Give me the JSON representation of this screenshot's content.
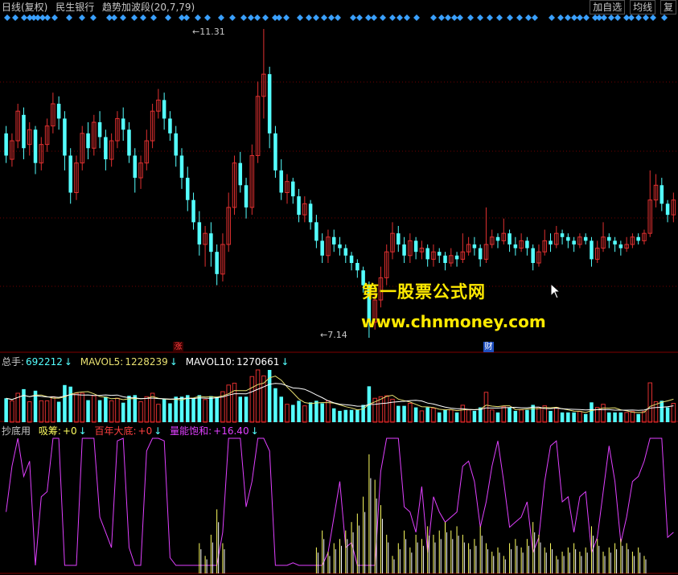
{
  "header": {
    "period": "日线(复权)",
    "stock_name": "民生银行",
    "indicator_name": "趋势加波段",
    "indicator_params": "(20,7,79)"
  },
  "toolbar_right": {
    "add_watchlist": "加自选",
    "ma_line": "均线",
    "extra": "复"
  },
  "price_panel": {
    "high_label": "11.31",
    "low_label": "7.14",
    "badge_up": "涨",
    "badge_fin": "财"
  },
  "volume_panel": {
    "total_label": "总手:",
    "total_value": "692212",
    "mavol5_label": "MAVOL5:",
    "mavol5_value": "1228239",
    "mavol10_label": "MAVOL10:",
    "mavol10_value": "1270661"
  },
  "indicator_panel": {
    "name": "抄底用",
    "s1_label": "吸筹:",
    "s1_value": "+0",
    "s2_label": "百年大底:",
    "s2_value": "+0",
    "s3_label": "量能饱和:",
    "s3_value": "+16.40"
  },
  "watermark": {
    "line1": "第一股票公式网",
    "line2": "www.chnmoney.com"
  },
  "colors": {
    "up": "#e03030",
    "down": "#54ffff",
    "ma5": "#ffffff",
    "ma10": "#e8e070",
    "purple": "#e040ff",
    "yellow": "#ffff60",
    "accent": "#ffea00",
    "signal": "#3aa0ff"
  },
  "chart_data": {
    "type": "candlestick",
    "price_range": [
      7.14,
      11.31
    ],
    "signal_markers": [
      9,
      19,
      30,
      37,
      42,
      47,
      53,
      59,
      68,
      86,
      102,
      116,
      136,
      142,
      153,
      167,
      178,
      191,
      209,
      226,
      232,
      246,
      258,
      275,
      289,
      303,
      312,
      320,
      330,
      342,
      347,
      356,
      373,
      384,
      393,
      403,
      412,
      420,
      439,
      447,
      458,
      465,
      476,
      488,
      497,
      506,
      518,
      539,
      549,
      557,
      565,
      572,
      585,
      597,
      609,
      621,
      634,
      646,
      657,
      665,
      686,
      697,
      706,
      714,
      721,
      729,
      740,
      745,
      751,
      760,
      768,
      779,
      785,
      794,
      803,
      812,
      826
    ],
    "candles": [
      [
        9.9,
        9.6,
        10.0,
        9.5
      ],
      [
        9.55,
        9.8,
        9.9,
        9.45
      ],
      [
        9.8,
        10.2,
        10.3,
        9.7
      ],
      [
        10.15,
        9.7,
        10.25,
        9.55
      ],
      [
        9.75,
        9.95,
        10.05,
        9.6
      ],
      [
        9.95,
        9.5,
        10.0,
        9.35
      ],
      [
        9.5,
        9.75,
        9.85,
        9.4
      ],
      [
        9.75,
        10.0,
        10.1,
        9.65
      ],
      [
        10.0,
        10.3,
        10.45,
        9.9
      ],
      [
        10.3,
        10.1,
        10.4,
        9.95
      ],
      [
        10.1,
        9.6,
        10.2,
        9.4
      ],
      [
        9.6,
        9.1,
        9.7,
        8.95
      ],
      [
        9.1,
        9.5,
        9.6,
        9.0
      ],
      [
        9.5,
        9.9,
        10.0,
        9.4
      ],
      [
        9.9,
        9.7,
        10.05,
        9.55
      ],
      [
        9.7,
        10.05,
        10.15,
        9.6
      ],
      [
        10.05,
        9.85,
        10.2,
        9.7
      ],
      [
        9.85,
        9.55,
        9.95,
        9.4
      ],
      [
        9.55,
        9.8,
        9.9,
        9.45
      ],
      [
        9.8,
        10.1,
        10.2,
        9.7
      ],
      [
        10.1,
        9.95,
        10.25,
        9.8
      ],
      [
        9.95,
        9.6,
        10.05,
        9.5
      ],
      [
        9.6,
        9.3,
        9.7,
        9.1
      ],
      [
        9.3,
        9.5,
        9.6,
        9.15
      ],
      [
        9.5,
        9.8,
        9.95,
        9.4
      ],
      [
        9.8,
        10.2,
        10.3,
        9.7
      ],
      [
        10.2,
        10.35,
        10.5,
        10.1
      ],
      [
        10.35,
        10.1,
        10.45,
        9.95
      ],
      [
        10.1,
        9.9,
        10.2,
        9.8
      ],
      [
        9.9,
        9.6,
        10.0,
        9.45
      ],
      [
        9.6,
        9.3,
        9.7,
        9.15
      ],
      [
        9.3,
        9.0,
        9.45,
        8.85
      ],
      [
        9.0,
        8.7,
        9.1,
        8.6
      ],
      [
        8.7,
        8.4,
        8.85,
        8.25
      ],
      [
        8.4,
        8.55,
        8.65,
        8.1
      ],
      [
        8.55,
        8.3,
        8.7,
        8.1
      ],
      [
        8.3,
        8.0,
        8.4,
        7.85
      ],
      [
        8.0,
        8.4,
        8.55,
        7.9
      ],
      [
        8.4,
        8.9,
        9.1,
        8.3
      ],
      [
        8.9,
        9.5,
        9.6,
        8.8
      ],
      [
        9.5,
        9.2,
        9.65,
        9.1
      ],
      [
        9.2,
        8.9,
        9.3,
        8.75
      ],
      [
        8.9,
        9.6,
        9.75,
        8.8
      ],
      [
        9.6,
        10.4,
        10.6,
        9.5
      ],
      [
        10.4,
        10.7,
        11.31,
        10.1
      ],
      [
        10.7,
        9.9,
        10.8,
        9.7
      ],
      [
        9.9,
        9.4,
        10.0,
        9.3
      ],
      [
        9.4,
        9.1,
        9.55,
        9.0
      ],
      [
        9.1,
        9.25,
        9.35,
        8.95
      ],
      [
        9.25,
        9.05,
        9.3,
        8.95
      ],
      [
        9.05,
        8.8,
        9.15,
        8.7
      ],
      [
        8.8,
        8.95,
        9.05,
        8.7
      ],
      [
        8.95,
        8.7,
        9.0,
        8.6
      ],
      [
        8.7,
        8.45,
        8.8,
        8.35
      ],
      [
        8.45,
        8.25,
        8.55,
        8.15
      ],
      [
        8.25,
        8.5,
        8.6,
        8.15
      ],
      [
        8.5,
        8.4,
        8.6,
        8.3
      ],
      [
        8.4,
        8.35,
        8.5,
        8.25
      ],
      [
        8.35,
        8.25,
        8.4,
        8.15
      ],
      [
        8.25,
        8.15,
        8.3,
        8.05
      ],
      [
        8.15,
        8.05,
        8.2,
        7.95
      ],
      [
        8.05,
        7.85,
        8.1,
        7.75
      ],
      [
        7.85,
        7.35,
        7.9,
        7.14
      ],
      [
        7.35,
        7.65,
        7.75,
        7.25
      ],
      [
        7.65,
        7.95,
        8.1,
        7.55
      ],
      [
        7.95,
        8.3,
        8.4,
        7.85
      ],
      [
        8.3,
        8.55,
        8.7,
        8.2
      ],
      [
        8.55,
        8.4,
        8.65,
        8.3
      ],
      [
        8.4,
        8.25,
        8.5,
        8.15
      ],
      [
        8.25,
        8.45,
        8.55,
        8.15
      ],
      [
        8.45,
        8.3,
        8.5,
        8.2
      ],
      [
        8.3,
        8.35,
        8.45,
        8.2
      ],
      [
        8.35,
        8.2,
        8.4,
        8.1
      ],
      [
        8.2,
        8.3,
        8.4,
        8.1
      ],
      [
        8.3,
        8.25,
        8.35,
        8.15
      ],
      [
        8.25,
        8.15,
        8.3,
        8.05
      ],
      [
        8.15,
        8.25,
        8.35,
        8.1
      ],
      [
        8.25,
        8.2,
        8.3,
        8.1
      ],
      [
        8.2,
        8.3,
        8.55,
        8.15
      ],
      [
        8.3,
        8.4,
        8.5,
        8.25
      ],
      [
        8.4,
        8.35,
        8.5,
        8.25
      ],
      [
        8.35,
        8.2,
        8.4,
        8.1
      ],
      [
        8.2,
        8.4,
        8.9,
        8.15
      ],
      [
        8.4,
        8.5,
        8.6,
        8.35
      ],
      [
        8.5,
        8.45,
        8.55,
        8.35
      ],
      [
        8.45,
        8.55,
        8.75,
        8.4
      ],
      [
        8.55,
        8.4,
        8.6,
        8.3
      ],
      [
        8.4,
        8.35,
        8.5,
        8.25
      ],
      [
        8.35,
        8.45,
        8.55,
        8.3
      ],
      [
        8.45,
        8.35,
        8.5,
        8.25
      ],
      [
        8.35,
        8.15,
        8.4,
        8.05
      ],
      [
        8.15,
        8.3,
        8.4,
        8.1
      ],
      [
        8.3,
        8.45,
        8.6,
        8.25
      ],
      [
        8.45,
        8.4,
        8.55,
        8.3
      ],
      [
        8.4,
        8.55,
        8.65,
        8.35
      ],
      [
        8.55,
        8.5,
        8.6,
        8.4
      ],
      [
        8.5,
        8.45,
        8.55,
        8.35
      ],
      [
        8.45,
        8.4,
        8.5,
        8.3
      ],
      [
        8.4,
        8.5,
        8.55,
        8.35
      ],
      [
        8.5,
        8.45,
        8.55,
        8.4
      ],
      [
        8.45,
        8.2,
        8.5,
        8.1
      ],
      [
        8.2,
        8.35,
        8.45,
        8.15
      ],
      [
        8.35,
        8.5,
        8.7,
        8.3
      ],
      [
        8.5,
        8.45,
        8.55,
        8.35
      ],
      [
        8.45,
        8.4,
        8.5,
        8.3
      ],
      [
        8.4,
        8.35,
        8.45,
        8.25
      ],
      [
        8.35,
        8.4,
        8.5,
        8.3
      ],
      [
        8.4,
        8.5,
        8.55,
        8.35
      ],
      [
        8.5,
        8.45,
        8.55,
        8.4
      ],
      [
        8.45,
        8.55,
        8.6,
        8.4
      ],
      [
        8.55,
        9.0,
        9.4,
        8.5
      ],
      [
        9.0,
        9.2,
        9.35,
        8.9
      ],
      [
        9.2,
        8.95,
        9.3,
        8.85
      ],
      [
        8.95,
        8.8,
        9.0,
        8.7
      ],
      [
        8.8,
        9.0,
        9.1,
        8.7
      ]
    ]
  }
}
